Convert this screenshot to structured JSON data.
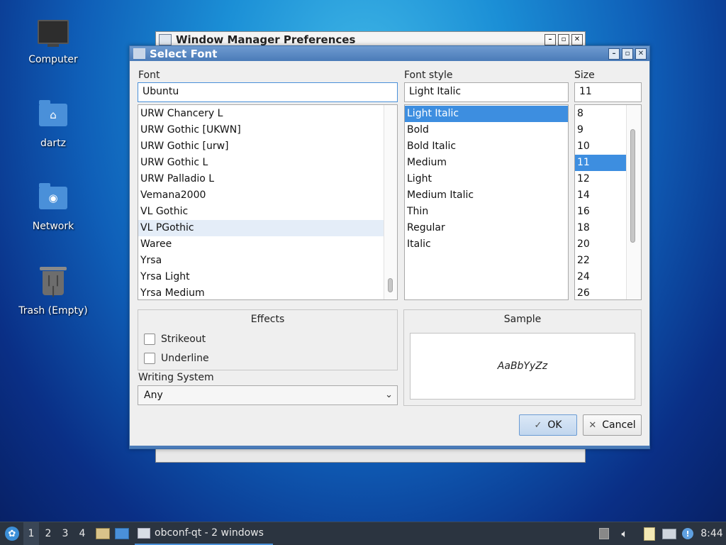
{
  "desktop": {
    "icons": [
      {
        "label": "Computer",
        "icon": "computer-icon"
      },
      {
        "label": "dartz",
        "icon": "home-folder-icon"
      },
      {
        "label": "Network",
        "icon": "network-folder-icon"
      },
      {
        "label": "Trash (Empty)",
        "icon": "trash-icon"
      }
    ]
  },
  "background_window": {
    "title": "Window Manager Preferences"
  },
  "dialog": {
    "title": "Select Font",
    "font_label": "Font",
    "font_value": "Ubuntu",
    "style_label": "Font style",
    "style_value": "Light Italic",
    "size_label": "Size",
    "size_value": "11",
    "fonts": [
      "URW Chancery L",
      "URW Gothic [UKWN]",
      "URW Gothic [urw]",
      "URW Gothic L",
      "URW Palladio L",
      "Vemana2000",
      "VL Gothic",
      "VL PGothic",
      "Waree",
      "Yrsa",
      "Yrsa Light",
      "Yrsa Medium"
    ],
    "hovered_font": "VL PGothic",
    "styles": [
      "Light Italic",
      "Bold",
      "Bold Italic",
      "Medium",
      "Light",
      "Medium Italic",
      "Thin",
      "Regular",
      "Italic"
    ],
    "selected_style": "Light Italic",
    "sizes": [
      "8",
      "9",
      "10",
      "11",
      "12",
      "14",
      "16",
      "18",
      "20",
      "22",
      "24",
      "26"
    ],
    "selected_size": "11",
    "effects_title": "Effects",
    "strikeout_label": "Strikeout",
    "strikeout_checked": false,
    "underline_label": "Underline",
    "underline_checked": false,
    "writing_system_label": "Writing System",
    "writing_system_value": "Any",
    "sample_title": "Sample",
    "sample_text": "AaBbYyZz",
    "ok_label": "OK",
    "cancel_label": "Cancel"
  },
  "taskbar": {
    "desktops": [
      "1",
      "2",
      "3",
      "4"
    ],
    "active_desktop": "1",
    "task_label": "obconf-qt - 2 windows",
    "clock": "8:44"
  },
  "colors": {
    "selection": "#3d8ee0",
    "titlebar": "#4a7bb8",
    "taskbar": "#2b3440"
  }
}
